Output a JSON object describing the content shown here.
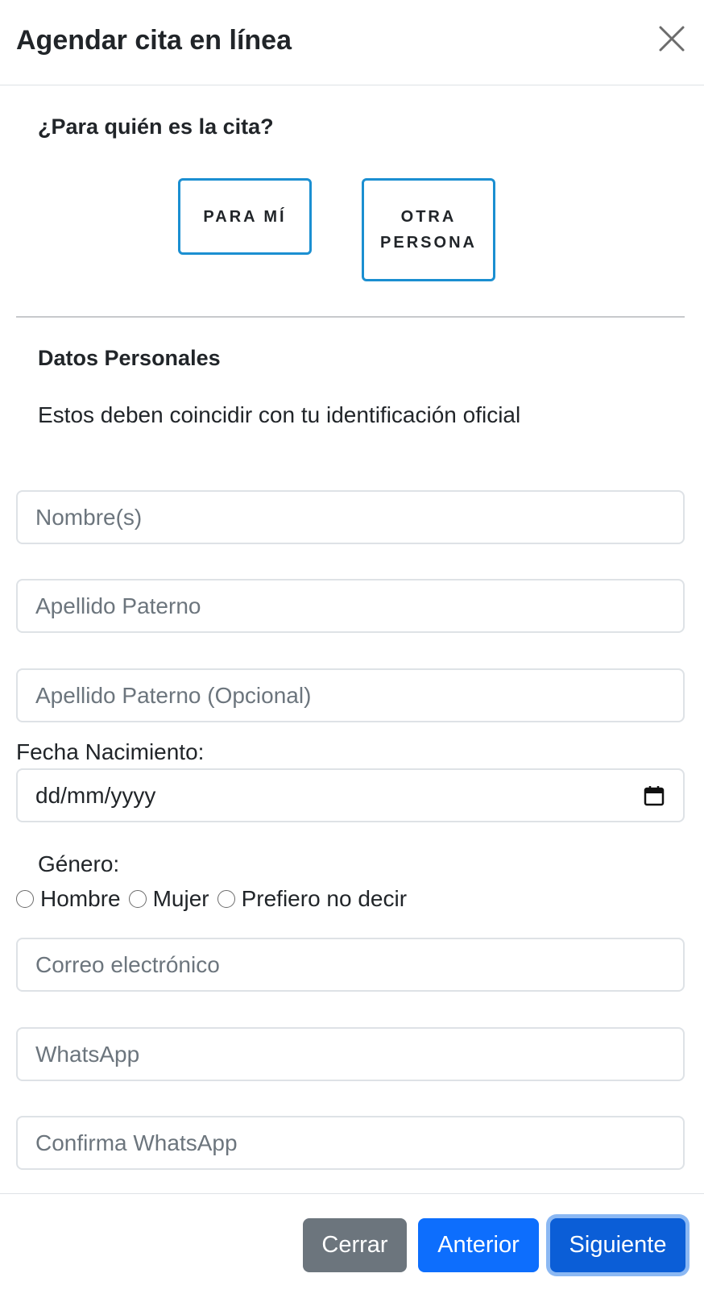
{
  "modal": {
    "title": "Agendar cita en línea",
    "close_icon": "close-icon"
  },
  "who": {
    "heading": "¿Para quién es la cita?",
    "option_me": "PARA MÍ",
    "option_other": "OTRA PERSONA"
  },
  "personal": {
    "heading": "Datos Personales",
    "subtitle": "Estos deben coincidir con tu identificación oficial",
    "nombre_placeholder": "Nombre(s)",
    "paterno_placeholder": "Apellido Paterno",
    "materno_placeholder": "Apellido Paterno (Opcional)",
    "fecha_label": "Fecha Nacimiento:",
    "fecha_value": "dd/mm/yyyy",
    "calendar_icon": "calendar-icon",
    "genero_label": "Género:",
    "genero_options": [
      "Hombre",
      "Mujer",
      "Prefiero no decir"
    ],
    "correo_placeholder": "Correo electrónico",
    "whatsapp_placeholder": "WhatsApp",
    "confirm_whatsapp_placeholder": "Confirma WhatsApp"
  },
  "footer": {
    "cerrar": "Cerrar",
    "anterior": "Anterior",
    "siguiente": "Siguiente"
  },
  "colors": {
    "primary": "#0d6efd",
    "secondary": "#6c757d",
    "choice_border": "#1b8fd1"
  }
}
